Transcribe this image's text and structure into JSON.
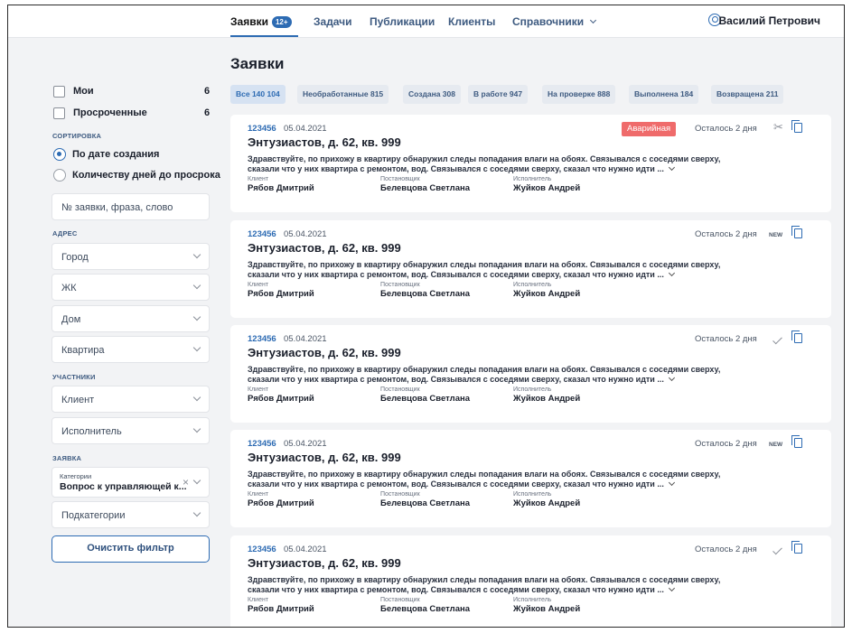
{
  "nav": {
    "tabs": [
      {
        "label": "Заявки",
        "badge": "12+"
      },
      {
        "label": "Задачи"
      },
      {
        "label": "Публикации"
      },
      {
        "label": "Клиенты"
      },
      {
        "label": "Справочники"
      }
    ],
    "user": "Василий Петрович"
  },
  "sidebar": {
    "checkboxes": [
      {
        "label": "Мои",
        "count": "6"
      },
      {
        "label": "Просроченные",
        "count": "6"
      }
    ],
    "sort_label": "СОРТИРОВКА",
    "sort_options": [
      "По дате создания",
      "Количеству дней до просрока"
    ],
    "search_placeholder": "№ заявки, фраза, слово",
    "address_label": "АДРЕС",
    "address_fields": [
      "Город",
      "ЖК",
      "Дом",
      "Квартира"
    ],
    "participants_label": "УЧАСТНИКИ",
    "participant_fields": [
      "Клиент",
      "Исполнитель"
    ],
    "request_label": "ЗАЯВКА",
    "category": {
      "label": "Категории",
      "value": "Вопрос к управляющей к..."
    },
    "subcategory": "Подкатегории",
    "clear_button": "Очистить фильтр"
  },
  "main": {
    "title": "Заявки",
    "chips": [
      "Все 140 104",
      "Необработанные 815",
      "Создана 308",
      "В работе 947",
      "На проверке 888",
      "Выполнена 184",
      "Возвращена 211"
    ],
    "cards": [
      {
        "num": "123456",
        "date": "05.04.2021",
        "address": "Энтузиастов, д. 62, кв. 999",
        "desc": "Здравствуйте, по прихожу в квартиру обнаружил следы попадания влаги на обоях. Связывался с соседями сверху, сказали что у них квартира с ремонтом, вод. Связывался с соседями сверху, сказал что нужно идти ...",
        "client_label": "Клиент",
        "client": "Рябов Дмитрий",
        "setter_label": "Постановщик",
        "setter": "Белевцова Светлана",
        "executor_label": "Исполнитель",
        "executor": "Жуйков Андрей",
        "remain": "Осталось 2 дня",
        "tag": "Аварийная",
        "icon": "tools-icon"
      },
      {
        "num": "123456",
        "date": "05.04.2021",
        "address": "Энтузиастов, д. 62, кв. 999",
        "desc": "Здравствуйте, по прихожу в квартиру обнаружил следы попадания влаги на обоях. Связывался с соседями сверху, сказали что у них квартира с ремонтом, вод. Связывался с соседями сверху, сказал что нужно идти ...",
        "client_label": "Клиент",
        "client": "Рябов Дмитрий",
        "setter_label": "Постановщик",
        "setter": "Белевцова Светлана",
        "executor_label": "Исполнитель",
        "executor": "Жуйков Андрей",
        "remain": "Осталось 2 дня",
        "tag": "NEW",
        "icon": "new-label"
      },
      {
        "num": "123456",
        "date": "05.04.2021",
        "address": "Энтузиастов, д. 62, кв. 999",
        "desc": "Здравствуйте, по прихожу в квартиру обнаружил следы попадания влаги на обоях. Связывался с соседями сверху, сказали что у них квартира с ремонтом, вод. Связывался с соседями сверху, сказал что нужно идти ...",
        "client_label": "Клиент",
        "client": "Рябов Дмитрий",
        "setter_label": "Постановщик",
        "setter": "Белевцова Светлана",
        "executor_label": "Исполнитель",
        "executor": "Жуйков Андрей",
        "remain": "Осталось 2 дня",
        "icon": "check-icon"
      },
      {
        "num": "123456",
        "date": "05.04.2021",
        "address": "Энтузиастов, д. 62, кв. 999",
        "desc": "Здравствуйте, по прихожу в квартиру обнаружил следы попадания влаги на обоях. Связывался с соседями сверху, сказали что у них квартира с ремонтом, вод. Связывался с соседями сверху, сказал что нужно идти ...",
        "client_label": "Клиент",
        "client": "Рябов Дмитрий",
        "setter_label": "Постановщик",
        "setter": "Белевцова Светлана",
        "executor_label": "Исполнитель",
        "executor": "Жуйков Андрей",
        "remain": "Осталось 2 дня",
        "tag": "NEW",
        "icon": "new-label"
      },
      {
        "num": "123456",
        "date": "05.04.2021",
        "address": "Энтузиастов, д. 62, кв. 999",
        "desc": "Здравствуйте, по прихожу в квартиру обнаружил следы попадания влаги на обоях. Связывался с соседями сверху, сказали что у них квартира с ремонтом, вод. Связывался с соседями сверху, сказал что нужно идти ...",
        "client_label": "Клиент",
        "client": "Рябов Дмитрий",
        "setter_label": "Постановщик",
        "setter": "Белевцова Светлана",
        "executor_label": "Исполнитель",
        "executor": "Жуйков Андрей",
        "remain": "Осталось 2 дня",
        "icon": "check-icon"
      }
    ]
  },
  "colors": {
    "accent": "#2d6bb3",
    "emergency": "#ef6b6b",
    "background": "#f2f3f5"
  }
}
